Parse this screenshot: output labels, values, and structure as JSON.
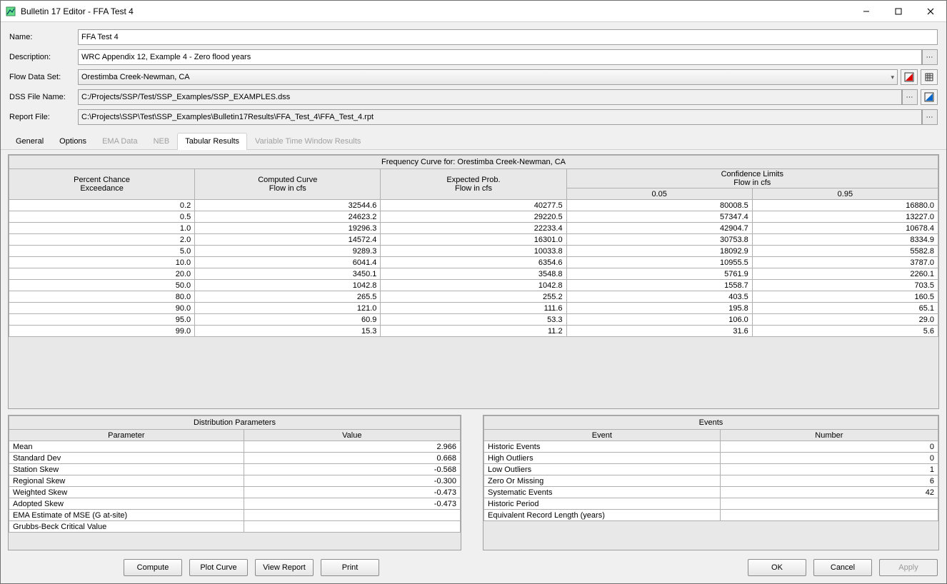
{
  "window": {
    "title": "Bulletin 17 Editor - FFA Test 4"
  },
  "labels": {
    "name": "Name:",
    "description": "Description:",
    "flowDataSet": "Flow Data Set:",
    "dssFileName": "DSS File Name:",
    "reportFile": "Report File:"
  },
  "fields": {
    "name": "FFA Test 4",
    "description": "WRC Appendix 12, Example 4 - Zero flood years",
    "flowDataSet": "Orestimba Creek-Newman, CA",
    "dssFileName": "C:/Projects/SSP/Test/SSP_Examples/SSP_EXAMPLES.dss",
    "reportFile": "C:\\Projects\\SSP\\Test\\SSP_Examples\\Bulletin17Results\\FFA_Test_4\\FFA_Test_4.rpt"
  },
  "tabs": {
    "general": "General",
    "options": "Options",
    "emaData": "EMA Data",
    "neb": "NEB",
    "tabularResults": "Tabular Results",
    "varTime": "Variable Time Window Results"
  },
  "freq": {
    "caption": "Frequency Curve for: Orestimba Creek-Newman, CA",
    "headers": {
      "pce": "Percent Chance",
      "exceed": "Exceedance",
      "computed": "Computed Curve",
      "flowcfs": "Flow in cfs",
      "expected": "Expected Prob.",
      "conf": "Confidence Limits",
      "c005": "0.05",
      "c095": "0.95"
    },
    "rows": [
      {
        "p": "0.2",
        "c": "32544.6",
        "e": "40277.5",
        "l": "80008.5",
        "u": "16880.0"
      },
      {
        "p": "0.5",
        "c": "24623.2",
        "e": "29220.5",
        "l": "57347.4",
        "u": "13227.0"
      },
      {
        "p": "1.0",
        "c": "19296.3",
        "e": "22233.4",
        "l": "42904.7",
        "u": "10678.4"
      },
      {
        "p": "2.0",
        "c": "14572.4",
        "e": "16301.0",
        "l": "30753.8",
        "u": "8334.9"
      },
      {
        "p": "5.0",
        "c": "9289.3",
        "e": "10033.8",
        "l": "18092.9",
        "u": "5582.8"
      },
      {
        "p": "10.0",
        "c": "6041.4",
        "e": "6354.6",
        "l": "10955.5",
        "u": "3787.0"
      },
      {
        "p": "20.0",
        "c": "3450.1",
        "e": "3548.8",
        "l": "5761.9",
        "u": "2260.1"
      },
      {
        "p": "50.0",
        "c": "1042.8",
        "e": "1042.8",
        "l": "1558.7",
        "u": "703.5"
      },
      {
        "p": "80.0",
        "c": "265.5",
        "e": "255.2",
        "l": "403.5",
        "u": "160.5"
      },
      {
        "p": "90.0",
        "c": "121.0",
        "e": "111.6",
        "l": "195.8",
        "u": "65.1"
      },
      {
        "p": "95.0",
        "c": "60.9",
        "e": "53.3",
        "l": "106.0",
        "u": "29.0"
      },
      {
        "p": "99.0",
        "c": "15.3",
        "e": "11.2",
        "l": "31.6",
        "u": "5.6"
      }
    ]
  },
  "dist": {
    "caption": "Distribution Parameters",
    "col1": "Parameter",
    "col2": "Value",
    "rows": [
      {
        "p": "Mean",
        "v": "2.966"
      },
      {
        "p": "Standard Dev",
        "v": "0.668"
      },
      {
        "p": "Station Skew",
        "v": "-0.568"
      },
      {
        "p": "Regional Skew",
        "v": "-0.300"
      },
      {
        "p": "Weighted Skew",
        "v": "-0.473"
      },
      {
        "p": "Adopted Skew",
        "v": "-0.473"
      },
      {
        "p": "EMA Estimate of MSE (G at-site)",
        "v": ""
      },
      {
        "p": "Grubbs-Beck Critical Value",
        "v": ""
      }
    ]
  },
  "events": {
    "caption": "Events",
    "col1": "Event",
    "col2": "Number",
    "rows": [
      {
        "e": "Historic Events",
        "n": "0"
      },
      {
        "e": "High Outliers",
        "n": "0"
      },
      {
        "e": "Low Outliers",
        "n": "1"
      },
      {
        "e": "Zero Or Missing",
        "n": "6"
      },
      {
        "e": "Systematic Events",
        "n": "42"
      },
      {
        "e": "Historic Period",
        "n": ""
      },
      {
        "e": "Equivalent Record Length (years)",
        "n": ""
      }
    ]
  },
  "buttons": {
    "compute": "Compute",
    "plotCurve": "Plot Curve",
    "viewReport": "View Report",
    "print": "Print",
    "ok": "OK",
    "cancel": "Cancel",
    "apply": "Apply"
  }
}
